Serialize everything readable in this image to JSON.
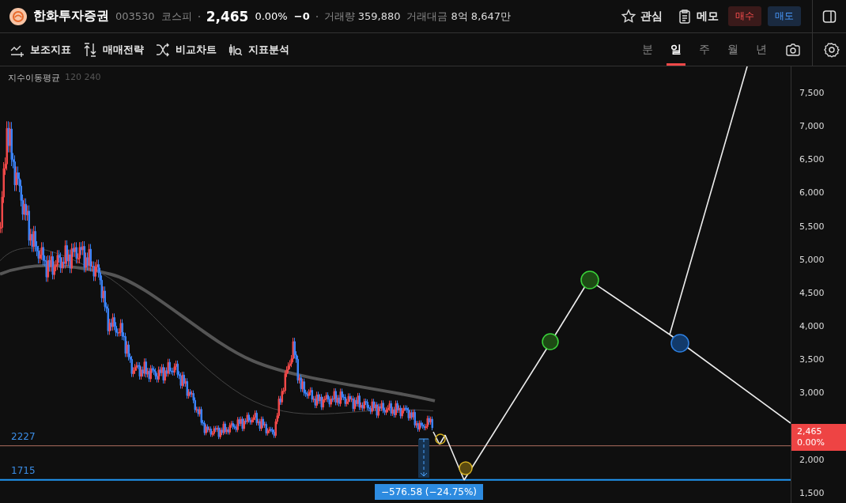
{
  "header": {
    "name": "한화투자증권",
    "code": "003530",
    "market": "코스피",
    "price": "2,465",
    "change_pct": "0.00%",
    "change": "−0",
    "volume_label": "거래량",
    "volume": "359,880",
    "amount_label": "거래대금",
    "amount": "8억 8,647만",
    "watch": "관심",
    "memo": "메모",
    "buy": "매수",
    "sell": "매도"
  },
  "toolbar": [
    {
      "kind": "indicator",
      "label": "보조지표"
    },
    {
      "kind": "strategy",
      "label": "매매전략"
    },
    {
      "kind": "compare",
      "label": "비교차트"
    },
    {
      "kind": "analysis",
      "label": "지표분석"
    }
  ],
  "periods": [
    {
      "label": "분",
      "selected": false
    },
    {
      "label": "일",
      "selected": true
    },
    {
      "label": "주",
      "selected": false
    },
    {
      "label": "월",
      "selected": false
    },
    {
      "label": "년",
      "selected": false
    }
  ],
  "legend": {
    "name": "지수이동평균",
    "params": "120 240"
  },
  "y_axis": [
    "7,500",
    "7,000",
    "6,500",
    "6,000",
    "5,500",
    "5,000",
    "4,500",
    "4,000",
    "3,500",
    "3,000",
    "2,000",
    "1,500"
  ],
  "levels": [
    {
      "label": "2227"
    },
    {
      "label": "1715"
    }
  ],
  "measure": "−576.58 (−24.75%)",
  "last_price": {
    "price": "2,465",
    "pct": "0.00%"
  }
}
